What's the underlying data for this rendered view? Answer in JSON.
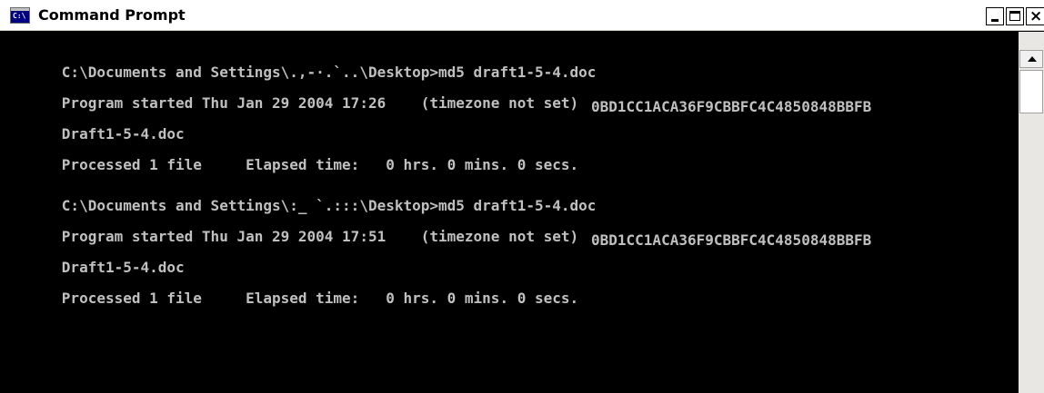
{
  "window": {
    "title": "Command Prompt",
    "icon_label": "C:\\"
  },
  "console": {
    "lines": [
      "C:\\Documents and Settings\\.,-·.`..\\Desktop>md5 draft1-5-4.doc",
      "Program started Thu Jan 29 2004 17:26    (timezone not set)",
      "Draft1-5-4.doc",
      "Processed 1 file     Elapsed time:   0 hrs. 0 mins. 0 secs.",
      "C:\\Documents and Settings\\:_ `.:::\\Desktop>md5 draft1-5-4.doc",
      "Program started Thu Jan 29 2004 17:51    (timezone not set)",
      "Draft1-5-4.doc",
      "Processed 1 file     Elapsed time:   0 hrs. 0 mins. 0 secs."
    ],
    "hashes": [
      "0BD1CC1ACA36F9CBBFC4C4850848BBFB",
      "0BD1CC1ACA36F9CBBFC4C4850848BBFB"
    ]
  }
}
